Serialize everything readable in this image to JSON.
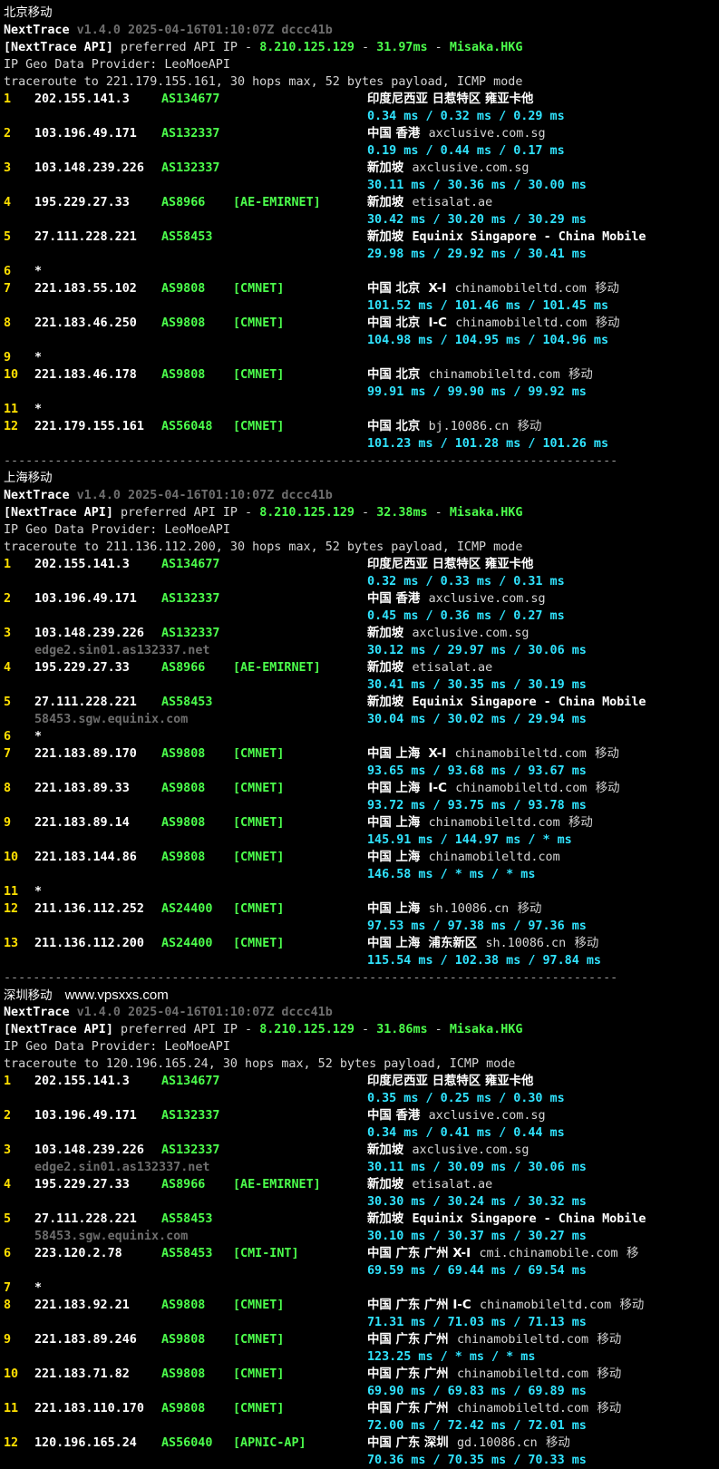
{
  "separator": "------------------------------------------------------------------------------------",
  "watermark": "www.vpsxxs.com",
  "sections": [
    {
      "title": "北京移动",
      "app_name": "NextTrace",
      "version": "v1.4.0 2025-04-16T01:10:07Z dccc41b",
      "api_tag": "[NextTrace API]",
      "api_text": " preferred API IP - ",
      "api_ip": "8.210.125.129",
      "api_dash": " - ",
      "api_latency": "31.97ms",
      "api_dash2": " - ",
      "api_node": "Misaka.HKG",
      "geo_provider": "IP Geo Data Provider: LeoMoeAPI",
      "traceroute": "traceroute to 221.179.155.161, 30 hops max, 52 bytes payload, ICMP mode",
      "hops": [
        {
          "num": "1",
          "ip": "202.155.141.3",
          "asn": "AS134677",
          "tag": "",
          "loc": "印度尼西亚 日惹特区 雍亚卡他",
          "host": "",
          "isp": "",
          "rtt": "0.34 ms / 0.32 ms / 0.29 ms",
          "rdns": ""
        },
        {
          "num": "2",
          "ip": "103.196.49.171",
          "asn": "AS132337",
          "tag": "",
          "loc": "中国 香港",
          "host": "axclusive.com.sg",
          "isp": "",
          "rtt": "0.19 ms / 0.44 ms / 0.17 ms",
          "rdns": ""
        },
        {
          "num": "3",
          "ip": "103.148.239.226",
          "asn": "AS132337",
          "tag": "",
          "loc": "新加坡",
          "host": "axclusive.com.sg",
          "isp": "",
          "rtt": "30.11 ms / 30.36 ms / 30.00 ms",
          "rdns": ""
        },
        {
          "num": "4",
          "ip": "195.229.27.33",
          "asn": "AS8966",
          "tag": "[AE-EMIRNET]",
          "loc": "新加坡",
          "host": "etisalat.ae",
          "isp": "",
          "rtt": "30.42 ms / 30.20 ms / 30.29 ms",
          "rdns": ""
        },
        {
          "num": "5",
          "ip": "27.111.228.221",
          "asn": "AS58453",
          "tag": "",
          "loc": "新加坡",
          "host": "Equinix Singapore - China Mobile",
          "isp": "",
          "rtt": "29.98 ms / 29.92 ms / 30.41 ms",
          "rdns": ""
        },
        {
          "num": "6",
          "star": "*"
        },
        {
          "num": "7",
          "ip": "221.183.55.102",
          "asn": "AS9808",
          "tag": "[CMNET]",
          "loc": "中国 北京  X-I",
          "host": "chinamobileltd.com",
          "isp": "移动",
          "rtt": "101.52 ms / 101.46 ms / 101.45 ms",
          "rdns": ""
        },
        {
          "num": "8",
          "ip": "221.183.46.250",
          "asn": "AS9808",
          "tag": "[CMNET]",
          "loc": "中国 北京  I-C",
          "host": "chinamobileltd.com",
          "isp": "移动",
          "rtt": "104.98 ms / 104.95 ms / 104.96 ms",
          "rdns": ""
        },
        {
          "num": "9",
          "star": "*"
        },
        {
          "num": "10",
          "ip": "221.183.46.178",
          "asn": "AS9808",
          "tag": "[CMNET]",
          "loc": "中国 北京",
          "host": "chinamobileltd.com",
          "isp": "移动",
          "rtt": "99.91 ms / 99.90 ms / 99.92 ms",
          "rdns": ""
        },
        {
          "num": "11",
          "star": "*"
        },
        {
          "num": "12",
          "ip": "221.179.155.161",
          "asn": "AS56048",
          "tag": "[CMNET]",
          "loc": "中国 北京",
          "host": "bj.10086.cn",
          "isp": "移动",
          "rtt": "101.23 ms / 101.28 ms / 101.26 ms",
          "rdns": ""
        }
      ]
    },
    {
      "title": "上海移动",
      "app_name": "NextTrace",
      "version": "v1.4.0 2025-04-16T01:10:07Z dccc41b",
      "api_tag": "[NextTrace API]",
      "api_text": " preferred API IP - ",
      "api_ip": "8.210.125.129",
      "api_dash": " - ",
      "api_latency": "32.38ms",
      "api_dash2": " - ",
      "api_node": "Misaka.HKG",
      "geo_provider": "IP Geo Data Provider: LeoMoeAPI",
      "traceroute": "traceroute to 211.136.112.200, 30 hops max, 52 bytes payload, ICMP mode",
      "hops": [
        {
          "num": "1",
          "ip": "202.155.141.3",
          "asn": "AS134677",
          "tag": "",
          "loc": "印度尼西亚 日惹特区 雍亚卡他",
          "host": "",
          "isp": "",
          "rtt": "0.32 ms / 0.33 ms / 0.31 ms",
          "rdns": ""
        },
        {
          "num": "2",
          "ip": "103.196.49.171",
          "asn": "AS132337",
          "tag": "",
          "loc": "中国 香港",
          "host": "axclusive.com.sg",
          "isp": "",
          "rtt": "0.45 ms / 0.36 ms / 0.27 ms",
          "rdns": ""
        },
        {
          "num": "3",
          "ip": "103.148.239.226",
          "asn": "AS132337",
          "tag": "",
          "loc": "新加坡",
          "host": "axclusive.com.sg",
          "isp": "",
          "rtt": "30.12 ms / 29.97 ms / 30.06 ms",
          "rdns": "edge2.sin01.as132337.net"
        },
        {
          "num": "4",
          "ip": "195.229.27.33",
          "asn": "AS8966",
          "tag": "[AE-EMIRNET]",
          "loc": "新加坡",
          "host": "etisalat.ae",
          "isp": "",
          "rtt": "30.41 ms / 30.35 ms / 30.19 ms",
          "rdns": ""
        },
        {
          "num": "5",
          "ip": "27.111.228.221",
          "asn": "AS58453",
          "tag": "",
          "loc": "新加坡",
          "host": "Equinix Singapore - China Mobile",
          "isp": "",
          "rtt": "30.04 ms / 30.02 ms / 29.94 ms",
          "rdns": "58453.sgw.equinix.com"
        },
        {
          "num": "6",
          "star": "*"
        },
        {
          "num": "7",
          "ip": "221.183.89.170",
          "asn": "AS9808",
          "tag": "[CMNET]",
          "loc": "中国 上海  X-I",
          "host": "chinamobileltd.com",
          "isp": "移动",
          "rtt": "93.65 ms / 93.68 ms / 93.67 ms",
          "rdns": ""
        },
        {
          "num": "8",
          "ip": "221.183.89.33",
          "asn": "AS9808",
          "tag": "[CMNET]",
          "loc": "中国 上海  I-C",
          "host": "chinamobileltd.com",
          "isp": "移动",
          "rtt": "93.72 ms / 93.75 ms / 93.78 ms",
          "rdns": ""
        },
        {
          "num": "9",
          "ip": "221.183.89.14",
          "asn": "AS9808",
          "tag": "[CMNET]",
          "loc": "中国 上海",
          "host": "chinamobileltd.com",
          "isp": "移动",
          "rtt": "145.91 ms / 144.97 ms / * ms",
          "rdns": ""
        },
        {
          "num": "10",
          "ip": "221.183.144.86",
          "asn": "AS9808",
          "tag": "[CMNET]",
          "loc": "中国 上海",
          "host": "chinamobileltd.com",
          "isp": "",
          "rtt": "146.58 ms / * ms / * ms",
          "rdns": ""
        },
        {
          "num": "11",
          "star": "*"
        },
        {
          "num": "12",
          "ip": "211.136.112.252",
          "asn": "AS24400",
          "tag": "[CMNET]",
          "loc": "中国 上海",
          "host": "sh.10086.cn",
          "isp": "移动",
          "rtt": "97.53 ms / 97.38 ms / 97.36 ms",
          "rdns": ""
        },
        {
          "num": "13",
          "ip": "211.136.112.200",
          "asn": "AS24400",
          "tag": "[CMNET]",
          "loc": "中国 上海  浦东新区",
          "host": "sh.10086.cn",
          "isp": "移动",
          "rtt": "115.54 ms / 102.38 ms / 97.84 ms",
          "rdns": ""
        }
      ]
    },
    {
      "title": "深圳移动",
      "has_watermark": true,
      "app_name": "NextTrace",
      "version": "v1.4.0 2025-04-16T01:10:07Z dccc41b",
      "api_tag": "[NextTrace API]",
      "api_text": " preferred API IP - ",
      "api_ip": "8.210.125.129",
      "api_dash": " - ",
      "api_latency": "31.86ms",
      "api_dash2": " - ",
      "api_node": "Misaka.HKG",
      "geo_provider": "IP Geo Data Provider: LeoMoeAPI",
      "traceroute": "traceroute to 120.196.165.24, 30 hops max, 52 bytes payload, ICMP mode",
      "hops": [
        {
          "num": "1",
          "ip": "202.155.141.3",
          "asn": "AS134677",
          "tag": "",
          "loc": "印度尼西亚 日惹特区 雍亚卡他",
          "host": "",
          "isp": "",
          "rtt": "0.35 ms / 0.25 ms / 0.30 ms",
          "rdns": ""
        },
        {
          "num": "2",
          "ip": "103.196.49.171",
          "asn": "AS132337",
          "tag": "",
          "loc": "中国 香港",
          "host": "axclusive.com.sg",
          "isp": "",
          "rtt": "0.34 ms / 0.41 ms / 0.44 ms",
          "rdns": ""
        },
        {
          "num": "3",
          "ip": "103.148.239.226",
          "asn": "AS132337",
          "tag": "",
          "loc": "新加坡",
          "host": "axclusive.com.sg",
          "isp": "",
          "rtt": "30.11 ms / 30.09 ms / 30.06 ms",
          "rdns": "edge2.sin01.as132337.net"
        },
        {
          "num": "4",
          "ip": "195.229.27.33",
          "asn": "AS8966",
          "tag": "[AE-EMIRNET]",
          "loc": "新加坡",
          "host": "etisalat.ae",
          "isp": "",
          "rtt": "30.30 ms / 30.24 ms / 30.32 ms",
          "rdns": ""
        },
        {
          "num": "5",
          "ip": "27.111.228.221",
          "asn": "AS58453",
          "tag": "",
          "loc": "新加坡",
          "host": "Equinix Singapore - China Mobile",
          "isp": "",
          "rtt": "30.10 ms / 30.37 ms / 30.27 ms",
          "rdns": "58453.sgw.equinix.com"
        },
        {
          "num": "6",
          "ip": "223.120.2.78",
          "asn": "AS58453",
          "tag": "[CMI-INT]",
          "loc": "中国 广东 广州 X-I",
          "host": "cmi.chinamobile.com",
          "isp": "移",
          "rtt": "69.59 ms / 69.44 ms / 69.54 ms",
          "rdns": ""
        },
        {
          "num": "7",
          "star": "*"
        },
        {
          "num": "8",
          "ip": "221.183.92.21",
          "asn": "AS9808",
          "tag": "[CMNET]",
          "loc": "中国 广东 广州 I-C",
          "host": "chinamobileltd.com",
          "isp": "移动",
          "rtt": "71.31 ms / 71.03 ms / 71.13 ms",
          "rdns": ""
        },
        {
          "num": "9",
          "ip": "221.183.89.246",
          "asn": "AS9808",
          "tag": "[CMNET]",
          "loc": "中国 广东 广州",
          "host": "chinamobileltd.com",
          "isp": "移动",
          "rtt": "123.25 ms / * ms / * ms",
          "rdns": ""
        },
        {
          "num": "10",
          "ip": "221.183.71.82",
          "asn": "AS9808",
          "tag": "[CMNET]",
          "loc": "中国 广东 广州",
          "host": "chinamobileltd.com",
          "isp": "移动",
          "rtt": "69.90 ms / 69.83 ms / 69.89 ms",
          "rdns": ""
        },
        {
          "num": "11",
          "ip": "221.183.110.170",
          "asn": "AS9808",
          "tag": "[CMNET]",
          "loc": "中国 广东 广州",
          "host": "chinamobileltd.com",
          "isp": "移动",
          "rtt": "72.00 ms / 72.42 ms / 72.01 ms",
          "rdns": ""
        },
        {
          "num": "12",
          "ip": "120.196.165.24",
          "asn": "AS56040",
          "tag": "[APNIC-AP]",
          "loc": "中国 广东 深圳",
          "host": "gd.10086.cn",
          "isp": "移动",
          "rtt": "70.36 ms / 70.35 ms / 70.33 ms",
          "rdns": ""
        }
      ]
    }
  ]
}
